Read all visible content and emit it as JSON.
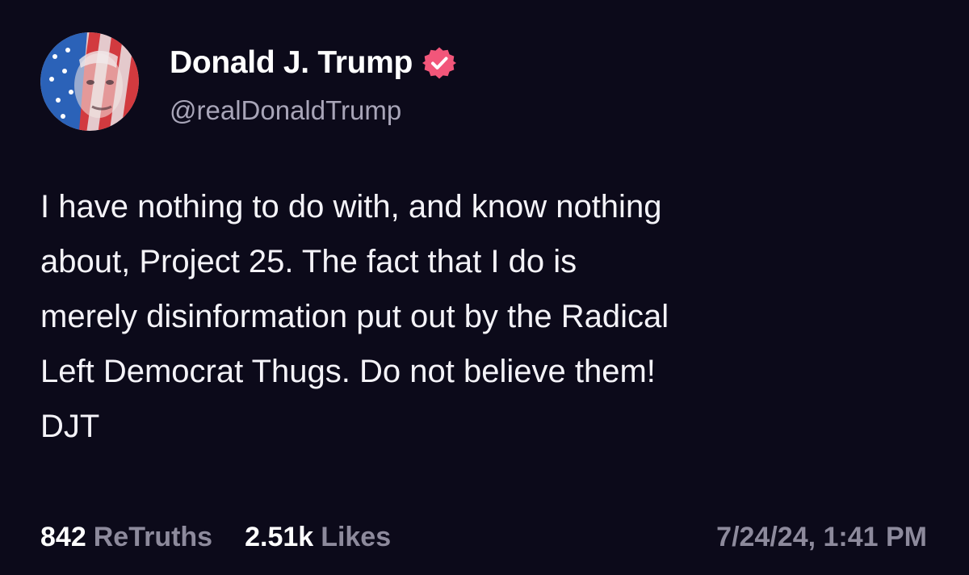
{
  "author": {
    "display_name": "Donald J. Trump",
    "handle": "@realDonaldTrump",
    "verified": true,
    "verified_color": "#f2567a"
  },
  "post": {
    "lines": [
      "I have nothing to do with, and know nothing",
      "about, Project 25. The fact that I do is",
      "merely disinformation put out by the Radical",
      "Left Democrat Thugs. Do not believe them!",
      "DJT"
    ]
  },
  "stats": {
    "retruths_count": "842",
    "retruths_label": "ReTruths",
    "likes_count": "2.51k",
    "likes_label": "Likes"
  },
  "timestamp": "7/24/24, 1:41 PM",
  "colors": {
    "background": "#0c0a1a",
    "text": "#f4f3f8",
    "muted": "#8d8a9c",
    "handle": "#a8a5b8"
  }
}
